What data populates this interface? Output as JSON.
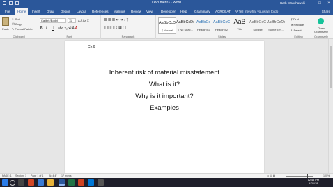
{
  "titlebar": {
    "document_title": "Document3 - Word",
    "user_name": "Barb Wanchawski",
    "window_controls": [
      "–",
      "□",
      "×"
    ]
  },
  "tabs": [
    {
      "label": "File"
    },
    {
      "label": "Home"
    },
    {
      "label": "Insert"
    },
    {
      "label": "Draw"
    },
    {
      "label": "Design"
    },
    {
      "label": "Layout"
    },
    {
      "label": "References"
    },
    {
      "label": "Mailings"
    },
    {
      "label": "Review"
    },
    {
      "label": "View"
    },
    {
      "label": "Developer"
    },
    {
      "label": "Help"
    },
    {
      "label": "Grammarly"
    },
    {
      "label": "ACROBAT"
    }
  ],
  "tell_me": "Tell me what you want to do",
  "share_label": "Share",
  "ribbon": {
    "clipboard": {
      "paste": "Paste",
      "cut": "Cut",
      "copy": "Copy",
      "format_painter": "Format Painter",
      "label": "Clipboard"
    },
    "font": {
      "name": "Calibri (Body)",
      "size": "11",
      "bold": "B",
      "italic": "I",
      "underline": "U",
      "label": "Font"
    },
    "paragraph": {
      "label": "Paragraph"
    },
    "styles": {
      "items": [
        {
          "preview": "AaBbCcDc",
          "name": "¶ Normal"
        },
        {
          "preview": "AaBbCcDc",
          "name": "¶ No Spac..."
        },
        {
          "preview": "AaBbCc",
          "name": "Heading 1"
        },
        {
          "preview": "AaBbCcC",
          "name": "Heading 2"
        },
        {
          "preview": "AaB",
          "name": "Title"
        },
        {
          "preview": "AaBbCcC",
          "name": "Subtitle"
        },
        {
          "preview": "AaBbCcDc",
          "name": "Subtle Em..."
        }
      ],
      "label": "Styles"
    },
    "editing": {
      "find": "Find",
      "replace": "Replace",
      "select": "Select",
      "label": "Editing"
    },
    "grammarly": {
      "open": "Open Grammarly",
      "label": "Grammarly"
    }
  },
  "document": {
    "header_note": "Ch 9",
    "lines": [
      "Inherent risk of material misstatement",
      "What is it?",
      "Why is it important?",
      "Examples"
    ]
  },
  "statusbar": {
    "page": "PAGE: 1",
    "section": "Section: 1",
    "page_of": "Page 1 of 1",
    "at": "At: 4.4\"",
    "words": "17 words",
    "zoom": "100%"
  },
  "taskbar": {
    "time": "12:45 PM",
    "date": "4/26/18"
  }
}
